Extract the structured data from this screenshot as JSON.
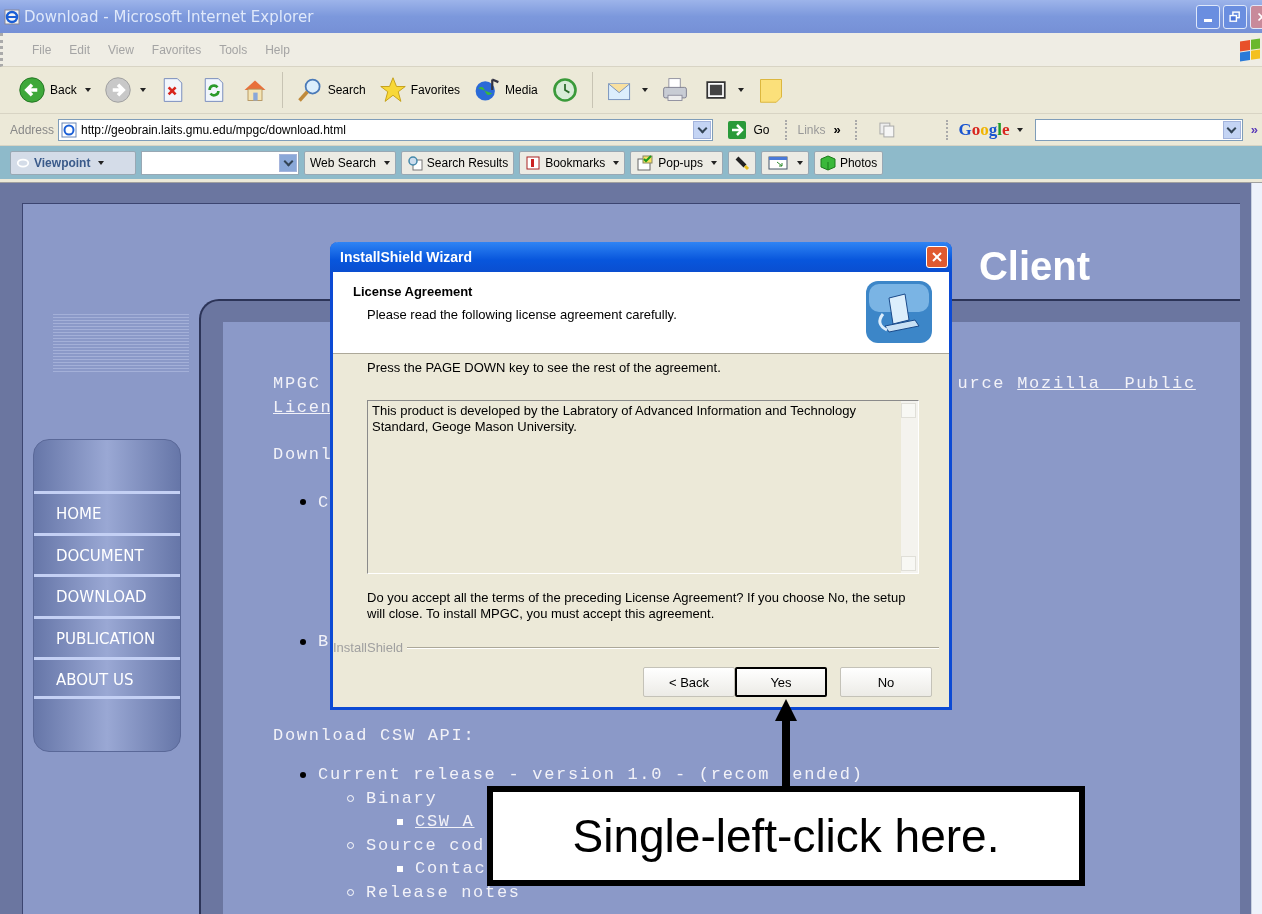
{
  "window": {
    "title": "Download - Microsoft Internet Explorer"
  },
  "menu": [
    "File",
    "Edit",
    "View",
    "Favorites",
    "Tools",
    "Help"
  ],
  "toolbar": [
    {
      "kind": "back",
      "label": "Back",
      "dropdown": true
    },
    {
      "kind": "forward",
      "dropdown": true
    },
    {
      "kind": "stop",
      "dropdown": false
    },
    {
      "kind": "refresh",
      "dropdown": false
    },
    {
      "kind": "home",
      "dropdown": false
    },
    {
      "kind": "search",
      "label": "Search",
      "dropdown": false
    },
    {
      "kind": "favorites",
      "label": "Favorites",
      "dropdown": false
    },
    {
      "kind": "media",
      "label": "Media",
      "dropdown": false
    },
    {
      "kind": "history",
      "dropdown": false
    },
    {
      "kind": "mail",
      "dropdown": true
    },
    {
      "kind": "print",
      "dropdown": false
    },
    {
      "kind": "edit",
      "dropdown": true
    },
    {
      "kind": "note",
      "dropdown": false
    }
  ],
  "address_bar": {
    "label": "Address",
    "url": "http://geobrain.laits.gmu.edu/mpgc/download.html",
    "go": "Go",
    "links": "Links",
    "links_more": "»",
    "search_brand": "Google",
    "more": "»"
  },
  "search_toolbar": {
    "brand": "Viewpoint",
    "buttons": [
      {
        "kind": "web-search",
        "label": "Web Search",
        "dropdown": true
      },
      {
        "kind": "results",
        "label": "Search Results",
        "dropdown": false
      },
      {
        "kind": "bookmarks",
        "label": "Bookmarks",
        "dropdown": true
      },
      {
        "kind": "popups",
        "label": "Pop-ups",
        "dropdown": true
      },
      {
        "kind": "highlight",
        "dropdown": false
      },
      {
        "kind": "window",
        "dropdown": true
      },
      {
        "kind": "photos",
        "label": "Photos",
        "dropdown": false
      }
    ]
  },
  "page": {
    "heading": "Client",
    "nav": [
      "HOME",
      "DOCUMENT",
      "DOWNLOAD",
      "PUBLICATION",
      "ABOUT US"
    ],
    "intro": "MPGC",
    "intro_right": "urce",
    "intro_link": "Mozilla Public",
    "intro_link_2": "Licen",
    "section_1": "Downl",
    "list_1": [
      {
        "text": "C"
      },
      {
        "text": "B"
      }
    ],
    "section_2": "Download CSW API:",
    "list_2": [
      {
        "text": "Current release - version 1.0 - (recom",
        "text_after": "ended)",
        "link": false,
        "children": [
          {
            "text": "Binary",
            "link": false,
            "children": [
              {
                "text": "CSW A",
                "link": true
              }
            ]
          },
          {
            "text": "Source cod",
            "link": false,
            "children": [
              {
                "text": "Contac",
                "link": false
              }
            ]
          },
          {
            "text": "Release notes",
            "link": false
          }
        ]
      }
    ]
  },
  "dialog": {
    "title": "InstallShield Wizard",
    "heading": "License Agreement",
    "subheading": "Please read the following license agreement carefully.",
    "instruction": "Press the PAGE DOWN key to see the rest of the agreement.",
    "license_text": "This product is developed by the Labratory of Advanced Information and Technology Standard, Geoge Mason University.",
    "question": "Do you accept all the terms of the preceding License Agreement?  If you choose No,  the setup will close.  To install MPGC, you must accept this agreement.",
    "group_label": "InstallShield",
    "buttons": [
      {
        "label": "< Back",
        "default": false
      },
      {
        "label": "Yes",
        "default": true
      },
      {
        "label": "No",
        "default": false
      }
    ]
  },
  "callout": {
    "text": "Single-left-click here."
  }
}
